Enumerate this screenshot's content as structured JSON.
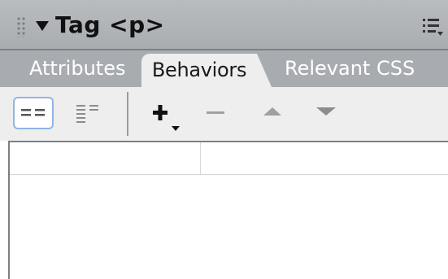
{
  "panel": {
    "title": "Tag <p>",
    "tabs": [
      {
        "label": "Attributes",
        "active": false
      },
      {
        "label": "Behaviors",
        "active": true
      },
      {
        "label": "Relevant CSS",
        "active": false
      }
    ]
  },
  "toolbar": {
    "view_modes": [
      {
        "icon": "show-set-events-icon",
        "selected": true
      },
      {
        "icon": "show-all-events-icon",
        "selected": false
      }
    ],
    "actions": [
      {
        "icon": "add-behavior-plus-icon",
        "enabled": true
      },
      {
        "icon": "remove-behavior-minus-icon",
        "enabled": false
      },
      {
        "icon": "move-up-triangle-icon",
        "enabled": false
      },
      {
        "icon": "move-down-triangle-icon",
        "enabled": false
      }
    ]
  },
  "behaviors_list": {
    "rows": []
  },
  "colors": {
    "header_bg": "#adb1b4",
    "tab_active_bg": "#eeeeee",
    "tab_inactive_text": "#ffffff",
    "selected_outline": "#8fb6e6",
    "disabled_icon": "#a0a0a0"
  }
}
